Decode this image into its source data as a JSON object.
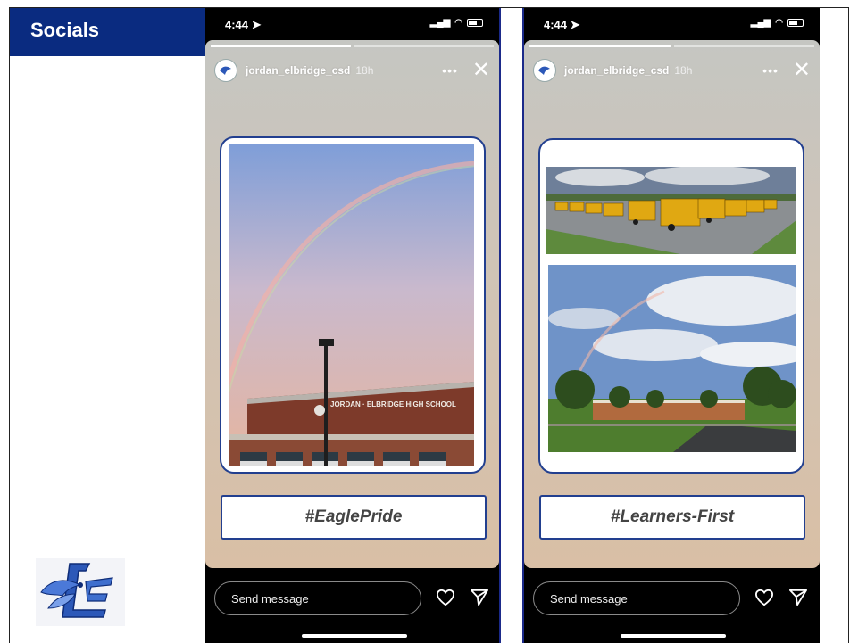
{
  "sidebar": {
    "title": "Socials"
  },
  "stories": [
    {
      "status_time": "4:44",
      "username": "jordan_elbridge_csd",
      "age": "18h",
      "hashtag": "#EaglePride",
      "building_sign": "JORDAN · ELBRIDGE HIGH SCHOOL",
      "send_placeholder": "Send message"
    },
    {
      "status_time": "4:44",
      "username": "jordan_elbridge_csd",
      "age": "18h",
      "hashtag": "#Learners-First",
      "send_placeholder": "Send message"
    }
  ],
  "colors": {
    "sidebar_header": "#0a2b80",
    "card_border": "#223f8f"
  },
  "icons": [
    "location-arrow-icon",
    "signal-icon",
    "wifi-icon",
    "battery-icon",
    "more-icon",
    "close-icon",
    "heart-icon",
    "send-icon",
    "district-logo"
  ]
}
